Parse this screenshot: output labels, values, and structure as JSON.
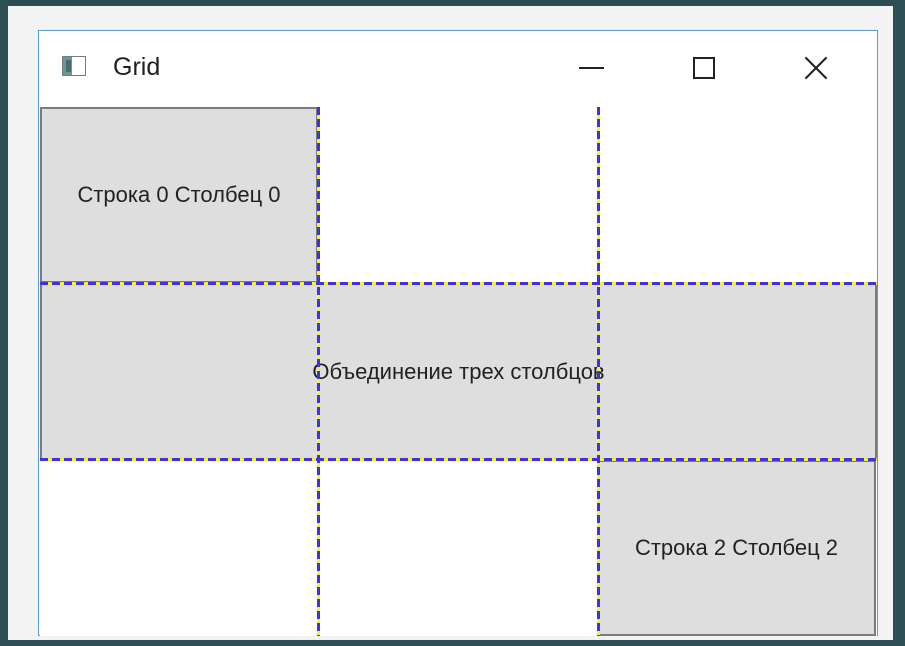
{
  "window": {
    "title": "Grid",
    "controls": {
      "minimize": "minimize-icon",
      "maximize": "maximize-icon",
      "close": "close-icon"
    }
  },
  "grid": {
    "cells": {
      "r0c0": "Строка 0 Столбец 0",
      "row1_span": "Объединение трех столбцов",
      "r2c2": "Строка 2 Столбец 2"
    }
  },
  "colors": {
    "outer_background": "#2d4f53",
    "frame_background": "#f3f3f3",
    "window_border": "#5b9bd5",
    "cell_background": "#dedede",
    "cell_border": "#7b7b7b",
    "grid_line_primary": "#3e33df",
    "grid_line_secondary": "#f7f42d"
  }
}
